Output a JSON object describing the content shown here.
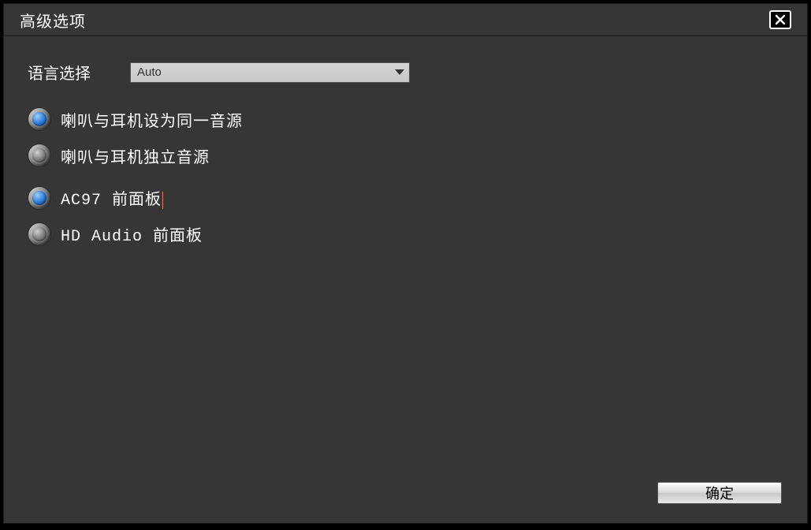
{
  "title": "高级选项",
  "language": {
    "label": "语言选择",
    "selected": "Auto"
  },
  "audio_source_group": {
    "options": [
      {
        "label": "喇叭与耳机设为同一音源",
        "selected": true
      },
      {
        "label": "喇叭与耳机独立音源",
        "selected": false
      }
    ]
  },
  "panel_group": {
    "options": [
      {
        "label": "AC97 前面板",
        "selected": true
      },
      {
        "label": "HD Audio 前面板",
        "selected": false
      }
    ]
  },
  "buttons": {
    "ok": "确定"
  }
}
